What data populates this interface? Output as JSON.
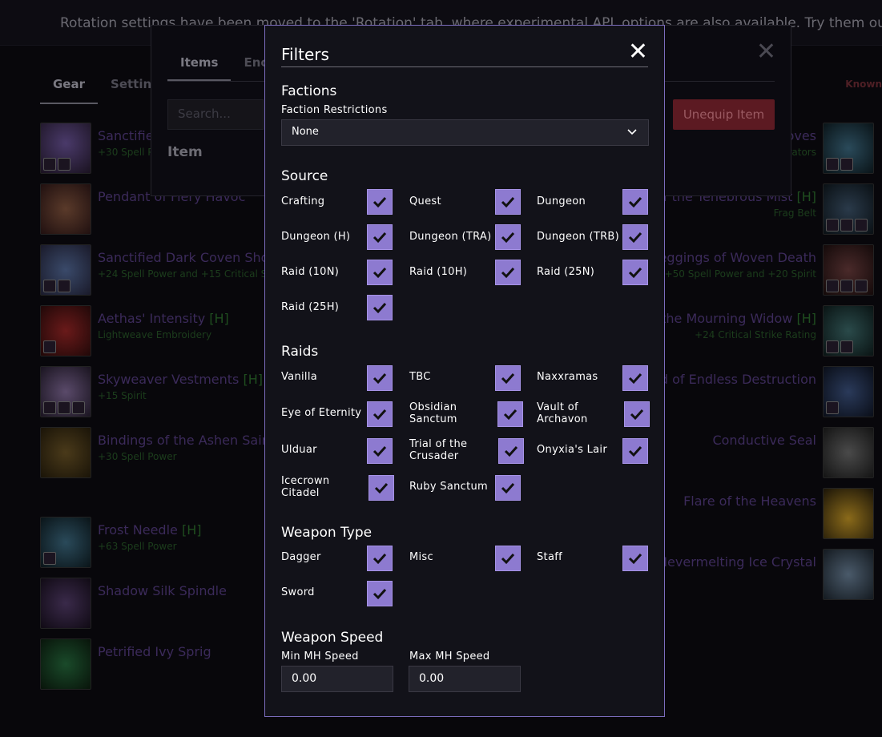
{
  "banner": {
    "text": "Rotation settings have been moved to the 'Rotation' tab, where experimental APL options are also available. Try them out!"
  },
  "gear_tabs": [
    "Gear",
    "Settings"
  ],
  "known_label": "Known",
  "left_items": [
    {
      "name": "Sanctified",
      "heroic": "",
      "enchant": "+30 Spell P"
    },
    {
      "name": "Pendant of Fiery Havoc",
      "heroic": "",
      "enchant": ""
    },
    {
      "name": "Sanctified Dark Coven Shou",
      "heroic": "",
      "enchant": "+24 Spell Power and +15 Critical Strike"
    },
    {
      "name": "Aethas' Intensity",
      "heroic": "[H]",
      "enchant": "Lightweave Embroidery"
    },
    {
      "name": "Skyweaver Vestments",
      "heroic": "[H]",
      "enchant": "+15 Spirit"
    },
    {
      "name": "Bindings of the Ashen Saint",
      "heroic": "",
      "enchant": "+30 Spell Power"
    },
    {
      "name": "Frost Needle",
      "heroic": "[H]",
      "enchant": "+63 Spell Power"
    },
    {
      "name": "Shadow Silk Spindle",
      "heroic": "",
      "enchant": ""
    },
    {
      "name": "Petrified Ivy Sprig",
      "heroic": "",
      "enchant": ""
    }
  ],
  "right_items": [
    {
      "name": "oves",
      "heroic": "",
      "enchant": "rators"
    },
    {
      "name": "of the Tenebrous Mist",
      "heroic": "[H]",
      "enchant": "Frag Belt"
    },
    {
      "name": "Leggings of Woven Death",
      "heroic": "",
      "enchant": "+50 Spell Power and +20 Spirit"
    },
    {
      "name": "the Mourning Widow",
      "heroic": "[H]",
      "enchant": "+24 Critical Strike Rating"
    },
    {
      "name": "nd of Endless Destruction",
      "heroic": "",
      "enchant": ""
    },
    {
      "name": "Conductive Seal",
      "heroic": "",
      "enchant": ""
    },
    {
      "name": "Flare of the Heavens",
      "heroic": "",
      "enchant": ""
    },
    {
      "name": "Nevermelting Ice Crystal",
      "heroic": "",
      "enchant": ""
    }
  ],
  "mid_modal": {
    "tabs": [
      "Items",
      "Encl"
    ],
    "search_placeholder": "Search...",
    "item_label": "Item",
    "unequip_label": "Unequip Item",
    "close_glyph": "✕"
  },
  "filters": {
    "title": "Filters",
    "close_glyph": "✕",
    "factions": {
      "heading": "Factions",
      "restrictions_label": "Faction Restrictions",
      "selected": "None",
      "chevron": "⌄"
    },
    "source": {
      "heading": "Source",
      "options": [
        "Crafting",
        "Quest",
        "Dungeon",
        "Dungeon (H)",
        "Dungeon (TRA)",
        "Dungeon (TRB)",
        "Raid (10N)",
        "Raid (10H)",
        "Raid (25N)",
        "Raid (25H)"
      ],
      "checked": [
        true,
        true,
        true,
        true,
        true,
        true,
        true,
        true,
        true,
        true
      ]
    },
    "raids": {
      "heading": "Raids",
      "options": [
        "Vanilla",
        "TBC",
        "Naxxramas",
        "Eye of Eternity",
        "Obsidian Sanctum",
        "Vault of Archavon",
        "Ulduar",
        "Trial of the Crusader",
        "Onyxia's Lair",
        "Icecrown Citadel",
        "Ruby Sanctum"
      ],
      "checked": [
        true,
        true,
        true,
        true,
        true,
        true,
        true,
        true,
        true,
        true,
        true
      ]
    },
    "weapon_type": {
      "heading": "Weapon Type",
      "options": [
        "Dagger",
        "Misc",
        "Staff",
        "Sword"
      ],
      "checked": [
        true,
        true,
        true,
        true
      ]
    },
    "weapon_speed": {
      "heading": "Weapon Speed",
      "min_label": "Min MH Speed",
      "max_label": "Max MH Speed",
      "min_value": "0.00",
      "max_value": "0.00"
    }
  },
  "colors": {
    "accent": "#8d7ad0",
    "modal_border": "#7b6cbd",
    "danger": "#5c1a22"
  }
}
